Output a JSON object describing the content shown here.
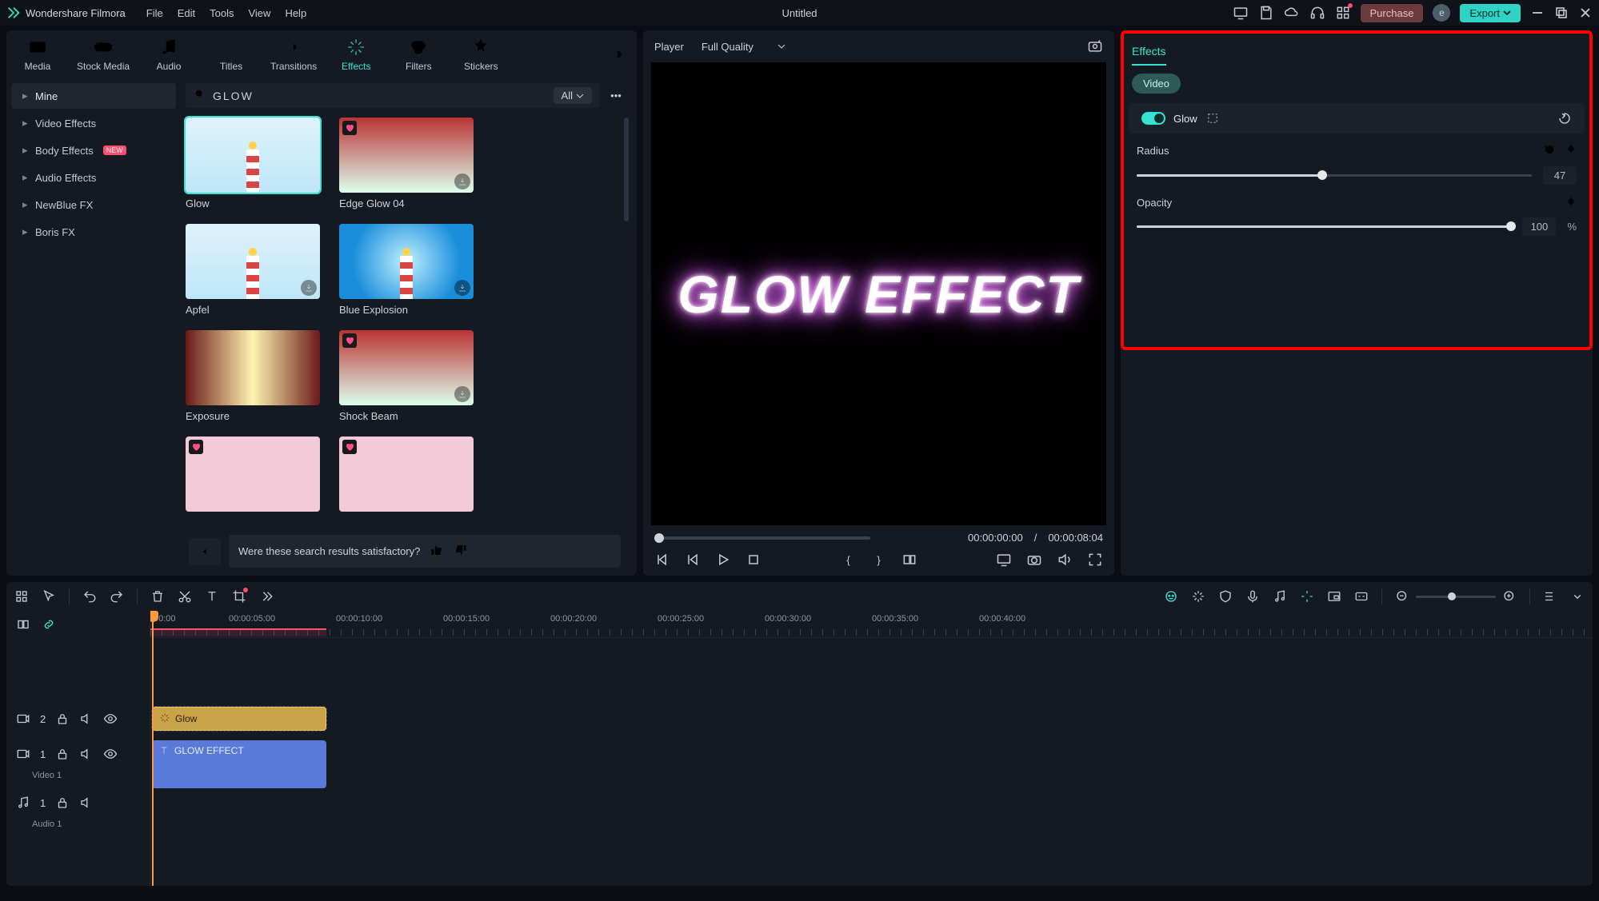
{
  "app": {
    "name": "Wondershare Filmora",
    "title": "Untitled"
  },
  "menus": {
    "file": "File",
    "edit": "Edit",
    "tools": "Tools",
    "view": "View",
    "help": "Help"
  },
  "titlebar": {
    "purchase": "Purchase",
    "avatar": "e",
    "export": "Export"
  },
  "tabs": {
    "media": "Media",
    "stock": "Stock Media",
    "audio": "Audio",
    "titles": "Titles",
    "transitions": "Transitions",
    "effects": "Effects",
    "filters": "Filters",
    "stickers": "Stickers"
  },
  "categories": {
    "mine": "Mine",
    "video_effects": "Video Effects",
    "body_effects": "Body Effects",
    "body_badge": "NEW",
    "audio_effects": "Audio Effects",
    "newblue": "NewBlue FX",
    "boris": "Boris FX"
  },
  "search": {
    "value": "GLOW",
    "all": "All"
  },
  "cards": {
    "c1": "Glow",
    "c2": "Edge Glow 04",
    "c3": "Apfel",
    "c4": "Blue Explosion",
    "c5": "Exposure",
    "c6": "Shock Beam"
  },
  "feedback": {
    "text": "Were these search results satisfactory?"
  },
  "player": {
    "label": "Player",
    "quality": "Full Quality",
    "current": "00:00:00:00",
    "sep": "/",
    "duration": "00:00:08:04",
    "glow_text": "GLOW EFFECT"
  },
  "panel": {
    "tab": "Effects",
    "sub": "Video",
    "glow": "Glow",
    "radius_label": "Radius",
    "radius_value": "47",
    "opacity_label": "Opacity",
    "opacity_value": "100",
    "opacity_unit": "%"
  },
  "timeline": {
    "marks": {
      "t0": "00:00",
      "t5": "00:00:05:00",
      "t10": "00:00:10:00",
      "t15": "00:00:15:00",
      "t20": "00:00:20:00",
      "t25": "00:00:25:00",
      "t30": "00:00:30:00",
      "t35": "00:00:35:00",
      "t40": "00:00:40:00"
    },
    "tracks": {
      "v2_n": "2",
      "v1_n": "1",
      "v1_name": "Video 1",
      "a1_n": "1",
      "a1_name": "Audio 1"
    },
    "clips": {
      "glow": "Glow",
      "text": "GLOW EFFECT"
    }
  }
}
